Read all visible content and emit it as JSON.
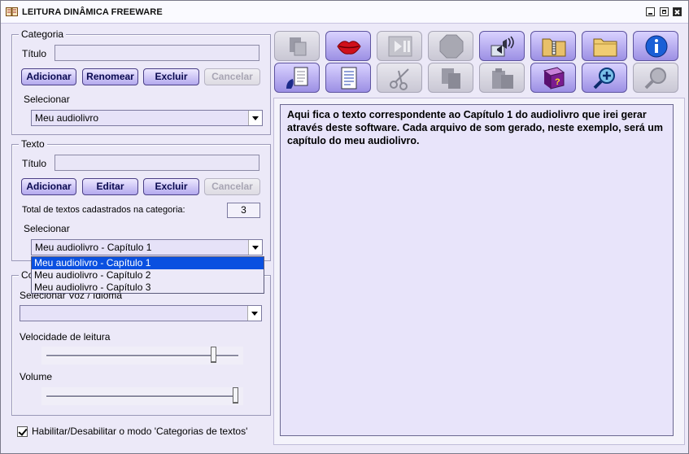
{
  "window": {
    "title": "LEITURA DINÂMICA FREEWARE"
  },
  "categoria": {
    "legend": "Categoria",
    "titulo_label": "Título",
    "titulo_value": "",
    "buttons": {
      "adicionar": "Adicionar",
      "renomear": "Renomear",
      "excluir": "Excluir",
      "cancelar": "Cancelar"
    },
    "selecionar_label": "Selecionar",
    "selected": "Meu audiolivro"
  },
  "texto": {
    "legend": "Texto",
    "titulo_label": "Título",
    "titulo_value": "",
    "buttons": {
      "adicionar": "Adicionar",
      "editar": "Editar",
      "excluir": "Excluir",
      "cancelar": "Cancelar"
    },
    "total_label": "Total de textos cadastrados na categoria:",
    "total_value": "3",
    "selecionar_label": "Selecionar",
    "selected": "Meu audiolivro - Capítulo 1",
    "options": [
      "Meu audiolivro - Capítulo 1",
      "Meu audiolivro - Capítulo 2",
      "Meu audiolivro - Capítulo 3"
    ]
  },
  "config": {
    "legend": "Co",
    "voz_label": "Selecionar Voz / Idioma",
    "voz_selected": "",
    "velocidade_label": "Velocidade de leitura",
    "velocidade_level": 0.88,
    "volume_label": "Volume",
    "volume_level": 1.0
  },
  "mode_toggle": {
    "label": "Habilitar/Desabilitar o modo 'Categorias de textos'",
    "checked": true
  },
  "content": {
    "text": "Aqui fica o texto correspondente ao Capítulo 1 do audiolivro que irei gerar através deste software. Cada arquivo de som gerado, neste exemplo, será um capítulo do meu audiolivro."
  },
  "toolbar": {
    "row1": [
      "paste-icon",
      "lips-icon",
      "play-pause-icon",
      "stop-icon",
      "speaker-icon",
      "zip-folder-icon",
      "folder-icon",
      "info-icon"
    ],
    "row2": [
      "speech-file-icon",
      "document-icon",
      "scissors-icon",
      "copy-icon",
      "clipboard-icon",
      "help-book-icon",
      "zoom-in-icon",
      "zoom-out-icon"
    ]
  },
  "colors": {
    "accent": "#b3a9ee",
    "panel": "#ece9f8",
    "selection": "#0a50e0"
  }
}
